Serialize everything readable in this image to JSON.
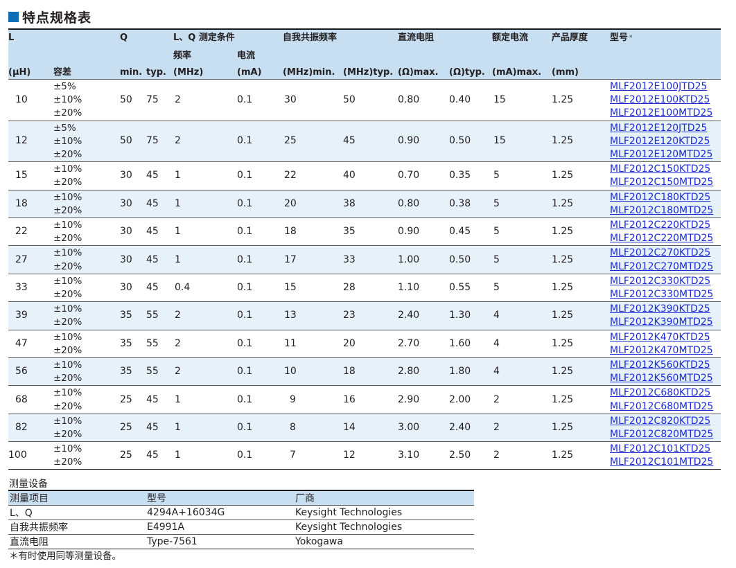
{
  "title": "特点规格表",
  "headers": {
    "l": "L",
    "q": "Q",
    "cond": "L、Q 测定条件",
    "freq": "频率",
    "curr": "电流",
    "srf": "自我共振频率",
    "dcr": "直流电阻",
    "rated": "额定电流",
    "thick": "产品厚度",
    "model": "型号",
    "model_mark": "*",
    "uh": "(µH)",
    "tol": "容差",
    "qmin": "min.",
    "qtyp": "typ.",
    "mhz": "(MHz)",
    "ma": "(mA)",
    "srfmin": "(MHz)min.",
    "srftyp": "(MHz)typ.",
    "dcrmax": "(Ω)max.",
    "dcrtyp": "(Ω)typ.",
    "ratedmax": "(mA)max.",
    "mm": "(mm)"
  },
  "rows": [
    {
      "l": "10",
      "tol": [
        "±5%",
        "±10%",
        "±20%"
      ],
      "qmin": "50",
      "qtyp": "75",
      "freq": "2",
      "curr": "0.1",
      "srfmin": "30",
      "srftyp": "50",
      "dcrmax": "0.80",
      "dcrtyp": "0.40",
      "rated": "15",
      "thick": "1.25",
      "models": [
        "MLF2012E100JTD25",
        "MLF2012E100KTD25",
        "MLF2012E100MTD25"
      ]
    },
    {
      "l": "12",
      "tol": [
        "±5%",
        "±10%",
        "±20%"
      ],
      "qmin": "50",
      "qtyp": "75",
      "freq": "2",
      "curr": "0.1",
      "srfmin": "25",
      "srftyp": "45",
      "dcrmax": "0.90",
      "dcrtyp": "0.50",
      "rated": "15",
      "thick": "1.25",
      "models": [
        "MLF2012E120JTD25",
        "MLF2012E120KTD25",
        "MLF2012E120MTD25"
      ]
    },
    {
      "l": "15",
      "tol": [
        "±10%",
        "±20%"
      ],
      "qmin": "30",
      "qtyp": "45",
      "freq": "1",
      "curr": "0.1",
      "srfmin": "22",
      "srftyp": "40",
      "dcrmax": "0.70",
      "dcrtyp": "0.35",
      "rated": "5",
      "thick": "1.25",
      "models": [
        "MLF2012C150KTD25",
        "MLF2012C150MTD25"
      ]
    },
    {
      "l": "18",
      "tol": [
        "±10%",
        "±20%"
      ],
      "qmin": "30",
      "qtyp": "45",
      "freq": "1",
      "curr": "0.1",
      "srfmin": "20",
      "srftyp": "38",
      "dcrmax": "0.80",
      "dcrtyp": "0.38",
      "rated": "5",
      "thick": "1.25",
      "models": [
        "MLF2012C180KTD25",
        "MLF2012C180MTD25"
      ]
    },
    {
      "l": "22",
      "tol": [
        "±10%",
        "±20%"
      ],
      "qmin": "30",
      "qtyp": "45",
      "freq": "1",
      "curr": "0.1",
      "srfmin": "18",
      "srftyp": "35",
      "dcrmax": "0.90",
      "dcrtyp": "0.45",
      "rated": "5",
      "thick": "1.25",
      "models": [
        "MLF2012C220KTD25",
        "MLF2012C220MTD25"
      ]
    },
    {
      "l": "27",
      "tol": [
        "±10%",
        "±20%"
      ],
      "qmin": "30",
      "qtyp": "45",
      "freq": "1",
      "curr": "0.1",
      "srfmin": "17",
      "srftyp": "33",
      "dcrmax": "1.00",
      "dcrtyp": "0.50",
      "rated": "5",
      "thick": "1.25",
      "models": [
        "MLF2012C270KTD25",
        "MLF2012C270MTD25"
      ]
    },
    {
      "l": "33",
      "tol": [
        "±10%",
        "±20%"
      ],
      "qmin": "30",
      "qtyp": "45",
      "freq": "0.4",
      "curr": "0.1",
      "srfmin": "15",
      "srftyp": "28",
      "dcrmax": "1.10",
      "dcrtyp": "0.55",
      "rated": "5",
      "thick": "1.25",
      "models": [
        "MLF2012C330KTD25",
        "MLF2012C330MTD25"
      ]
    },
    {
      "l": "39",
      "tol": [
        "±10%",
        "±20%"
      ],
      "qmin": "35",
      "qtyp": "55",
      "freq": "2",
      "curr": "0.1",
      "srfmin": "13",
      "srftyp": "23",
      "dcrmax": "2.40",
      "dcrtyp": "1.30",
      "rated": "4",
      "thick": "1.25",
      "models": [
        "MLF2012K390KTD25",
        "MLF2012K390MTD25"
      ]
    },
    {
      "l": "47",
      "tol": [
        "±10%",
        "±20%"
      ],
      "qmin": "35",
      "qtyp": "55",
      "freq": "2",
      "curr": "0.1",
      "srfmin": "11",
      "srftyp": "20",
      "dcrmax": "2.70",
      "dcrtyp": "1.60",
      "rated": "4",
      "thick": "1.25",
      "models": [
        "MLF2012K470KTD25",
        "MLF2012K470MTD25"
      ]
    },
    {
      "l": "56",
      "tol": [
        "±10%",
        "±20%"
      ],
      "qmin": "35",
      "qtyp": "55",
      "freq": "2",
      "curr": "0.1",
      "srfmin": "10",
      "srftyp": "18",
      "dcrmax": "2.80",
      "dcrtyp": "1.80",
      "rated": "4",
      "thick": "1.25",
      "models": [
        "MLF2012K560KTD25",
        "MLF2012K560MTD25"
      ]
    },
    {
      "l": "68",
      "tol": [
        "±10%",
        "±20%"
      ],
      "qmin": "25",
      "qtyp": "45",
      "freq": "1",
      "curr": "0.1",
      "srfmin": "9",
      "srftyp": "16",
      "dcrmax": "2.90",
      "dcrtyp": "2.00",
      "rated": "2",
      "thick": "1.25",
      "models": [
        "MLF2012C680KTD25",
        "MLF2012C680MTD25"
      ]
    },
    {
      "l": "82",
      "tol": [
        "±10%",
        "±20%"
      ],
      "qmin": "25",
      "qtyp": "45",
      "freq": "1",
      "curr": "0.1",
      "srfmin": "8",
      "srftyp": "14",
      "dcrmax": "3.00",
      "dcrtyp": "2.40",
      "rated": "2",
      "thick": "1.25",
      "models": [
        "MLF2012C820KTD25",
        "MLF2012C820MTD25"
      ]
    },
    {
      "l": "100",
      "tol": [
        "±10%",
        "±20%"
      ],
      "qmin": "25",
      "qtyp": "45",
      "freq": "1",
      "curr": "0.1",
      "srfmin": "7",
      "srftyp": "12",
      "dcrmax": "3.10",
      "dcrtyp": "2.50",
      "rated": "2",
      "thick": "1.25",
      "models": [
        "MLF2012C101KTD25",
        "MLF2012C101MTD25"
      ]
    }
  ],
  "measurement": {
    "label": "测量设备",
    "headers": [
      "测量项目",
      "型号",
      "厂商"
    ],
    "rows": [
      [
        "L、Q",
        "4294A+16034G",
        "Keysight Technologies"
      ],
      [
        "自我共振频率",
        "E4991A",
        "Keysight Technologies"
      ],
      [
        "直流电阻",
        "Type-7561",
        "Yokogawa"
      ]
    ],
    "note": "＊有时使用同等测量设备。"
  }
}
